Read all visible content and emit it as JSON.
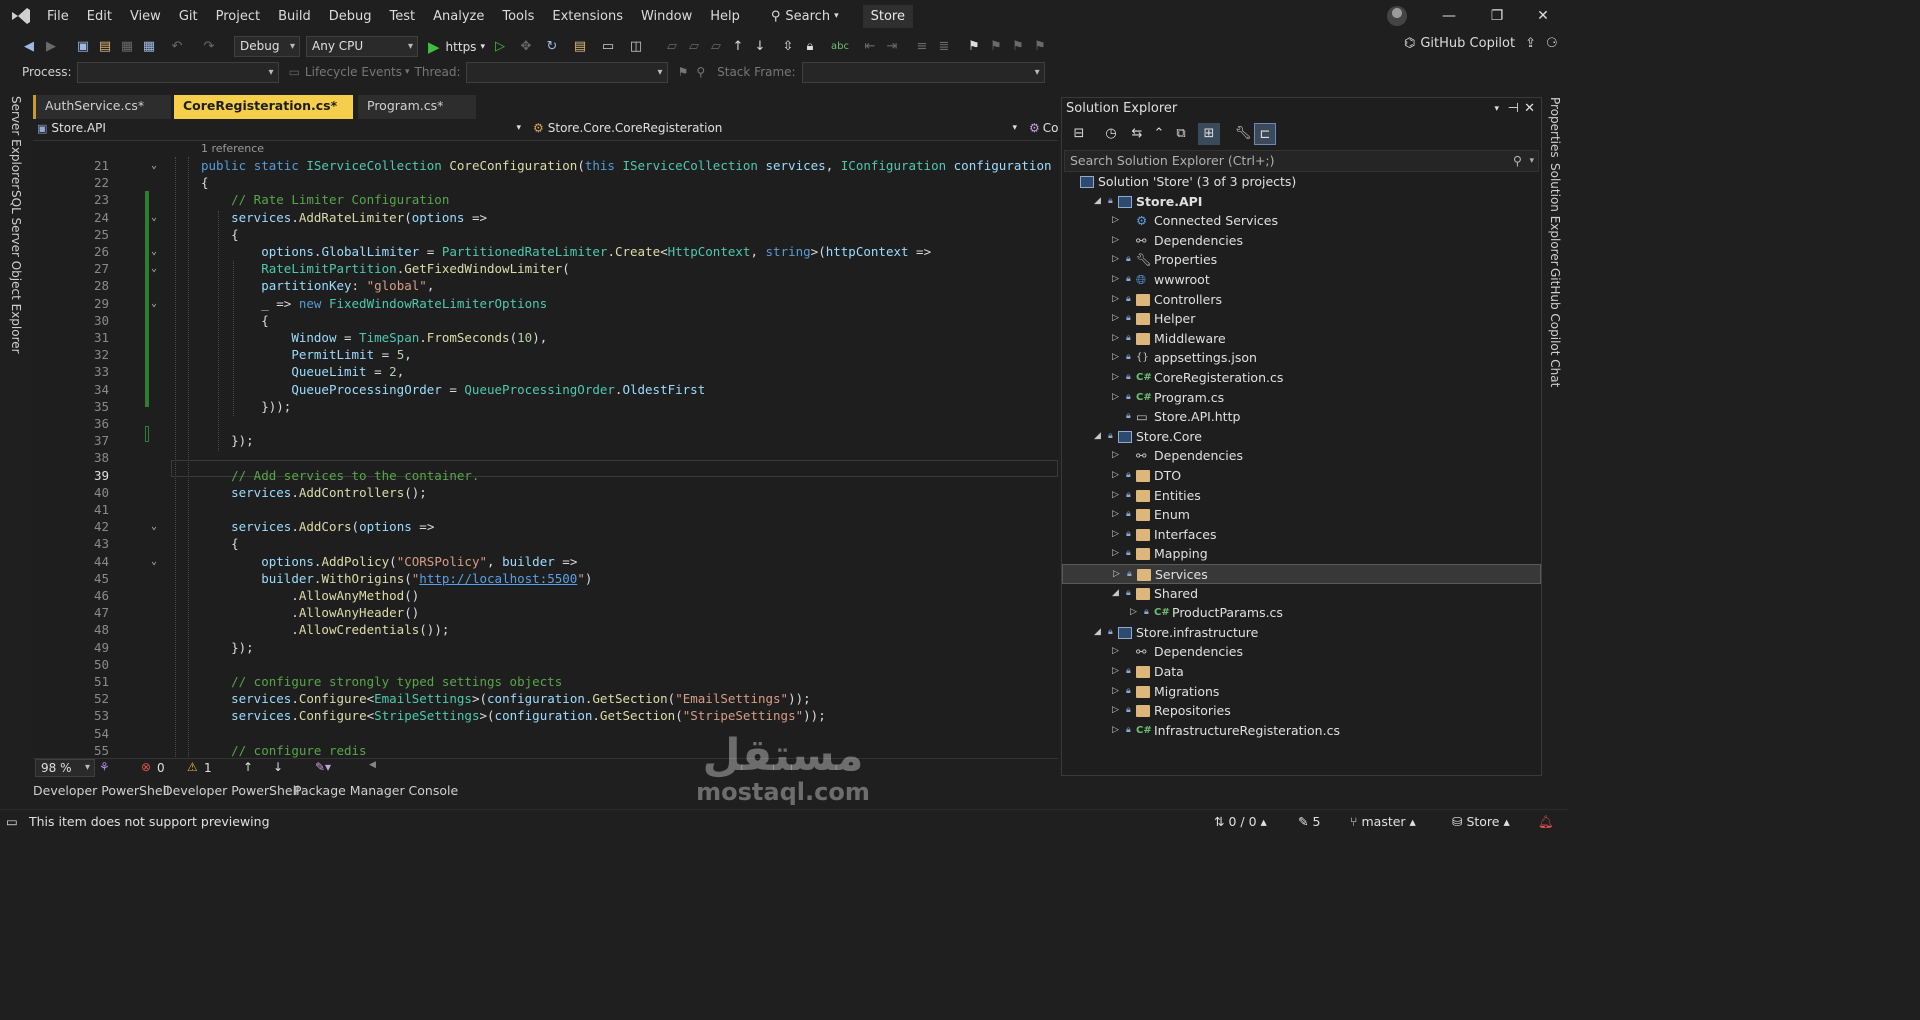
{
  "menu": {
    "items": [
      "File",
      "Edit",
      "View",
      "Git",
      "Project",
      "Build",
      "Debug",
      "Test",
      "Analyze",
      "Tools",
      "Extensions",
      "Window",
      "Help"
    ],
    "search_label": "Search",
    "solution_badge": "Store"
  },
  "toolbar": {
    "configuration": "Debug",
    "platform": "Any CPU",
    "run_target": "https",
    "copilot_label": "GitHub Copilot",
    "process_label": "Process:",
    "lifecycle_label": "Lifecycle Events",
    "thread_label": "Thread:",
    "stack_frame_label": "Stack Frame:"
  },
  "left_strip": {
    "server_explorer": "Server Explorer",
    "sql_explorer": "SQL Server Object Explorer"
  },
  "right_strip": {
    "properties": "Properties",
    "solution_explorer": "Solution Explorer",
    "copilot_chat": "GitHub Copilot Chat"
  },
  "editor": {
    "tabs": [
      "AuthService.cs*",
      "CoreRegisteration.cs*",
      "Program.cs*"
    ],
    "active_tab": "CoreRegisteration.cs*",
    "nav_project": "Store.API",
    "nav_class": "Store.Core.CoreRegisteration",
    "nav_member": "Co",
    "codelens": "1 reference",
    "zoom": "98 %",
    "errors": "0",
    "warnings": "1",
    "current_line": "39"
  },
  "code_lines": [
    {
      "n": "21",
      "t": "public static IServiceCollection CoreConfiguration(this IServiceCollection services, IConfiguration configuration"
    },
    {
      "n": "22",
      "t": "{"
    },
    {
      "n": "23",
      "t": "    // Rate Limiter Configuration"
    },
    {
      "n": "24",
      "t": "    services.AddRateLimiter(options =>"
    },
    {
      "n": "25",
      "t": "    {"
    },
    {
      "n": "26",
      "t": "        options.GlobalLimiter = PartitionedRateLimiter.Create<HttpContext, string>(httpContext =>"
    },
    {
      "n": "27",
      "t": "        RateLimitPartition.GetFixedWindowLimiter("
    },
    {
      "n": "28",
      "t": "        partitionKey: \"global\","
    },
    {
      "n": "29",
      "t": "        _ => new FixedWindowRateLimiterOptions"
    },
    {
      "n": "30",
      "t": "        {"
    },
    {
      "n": "31",
      "t": "            Window = TimeSpan.FromSeconds(10),"
    },
    {
      "n": "32",
      "t": "            PermitLimit = 5,"
    },
    {
      "n": "33",
      "t": "            QueueLimit = 2,"
    },
    {
      "n": "34",
      "t": "            QueueProcessingOrder = QueueProcessingOrder.OldestFirst"
    },
    {
      "n": "35",
      "t": "        }));"
    },
    {
      "n": "36",
      "t": ""
    },
    {
      "n": "37",
      "t": "    });"
    },
    {
      "n": "38",
      "t": ""
    },
    {
      "n": "39",
      "t": "    // Add services to the container."
    },
    {
      "n": "40",
      "t": "    services.AddControllers();"
    },
    {
      "n": "41",
      "t": ""
    },
    {
      "n": "42",
      "t": "    services.AddCors(options =>"
    },
    {
      "n": "43",
      "t": "    {"
    },
    {
      "n": "44",
      "t": "        options.AddPolicy(\"CORSPolicy\", builder =>"
    },
    {
      "n": "45",
      "t": "        builder.WithOrigins(\"http://localhost:5500\")"
    },
    {
      "n": "46",
      "t": "            .AllowAnyMethod()"
    },
    {
      "n": "47",
      "t": "            .AllowAnyHeader()"
    },
    {
      "n": "48",
      "t": "            .AllowCredentials());"
    },
    {
      "n": "49",
      "t": "    });"
    },
    {
      "n": "50",
      "t": ""
    },
    {
      "n": "51",
      "t": "    // configure strongly typed settings objects"
    },
    {
      "n": "52",
      "t": "    services.Configure<EmailSettings>(configuration.GetSection(\"EmailSettings\"));"
    },
    {
      "n": "53",
      "t": "    services.Configure<StripeSettings>(configuration.GetSection(\"StripeSettings\"));"
    },
    {
      "n": "54",
      "t": ""
    },
    {
      "n": "55",
      "t": "    // configure redis"
    }
  ],
  "solution_explorer": {
    "title": "Solution Explorer",
    "search_placeholder": "Search Solution Explorer (Ctrl+;)",
    "items": [
      {
        "label": "Solution 'Store' (3 of 3 projects)",
        "kind": "solution"
      },
      {
        "label": "Store.API",
        "kind": "project-bold"
      },
      {
        "label": "Connected Services",
        "kind": "service"
      },
      {
        "label": "Dependencies",
        "kind": "deps"
      },
      {
        "label": "Properties",
        "kind": "props"
      },
      {
        "label": "wwwroot",
        "kind": "globe"
      },
      {
        "label": "Controllers",
        "kind": "folder"
      },
      {
        "label": "Helper",
        "kind": "folder"
      },
      {
        "label": "Middleware",
        "kind": "folder"
      },
      {
        "label": "appsettings.json",
        "kind": "json"
      },
      {
        "label": "CoreRegisteration.cs",
        "kind": "cs"
      },
      {
        "label": "Program.cs",
        "kind": "cs"
      },
      {
        "label": "Store.API.http",
        "kind": "file"
      },
      {
        "label": "Store.Core",
        "kind": "project"
      },
      {
        "label": "Dependencies",
        "kind": "deps"
      },
      {
        "label": "DTO",
        "kind": "folder"
      },
      {
        "label": "Entities",
        "kind": "folder"
      },
      {
        "label": "Enum",
        "kind": "folder"
      },
      {
        "label": "Interfaces",
        "kind": "folder"
      },
      {
        "label": "Mapping",
        "kind": "folder"
      },
      {
        "label": "Services",
        "kind": "folder"
      },
      {
        "label": "Shared",
        "kind": "folder"
      },
      {
        "label": "ProductParams.cs",
        "kind": "cs"
      },
      {
        "label": "Store.infrastructure",
        "kind": "project"
      },
      {
        "label": "Dependencies",
        "kind": "deps"
      },
      {
        "label": "Data",
        "kind": "folder"
      },
      {
        "label": "Migrations",
        "kind": "folder"
      },
      {
        "label": "Repositories",
        "kind": "folder"
      },
      {
        "label": "InfrastructureRegisteration.cs",
        "kind": "cs"
      }
    ],
    "selected": "Services"
  },
  "bottom_tabs": [
    "Developer PowerShell",
    "Developer PowerShell",
    "Package Manager Console"
  ],
  "status": {
    "message": "This item does not support previewing",
    "changes": "0 / 0",
    "edits": "5",
    "branch": "master",
    "repo": "Store"
  },
  "watermark": {
    "arabic": "مستقل",
    "latin": "mostaql.com"
  },
  "colors": {
    "active_tab": "#f5cf4b",
    "keyword": "#569cd6",
    "type": "#4ec9b0",
    "method": "#dcdcaa",
    "string": "#d69d85",
    "comment": "#57a64a"
  }
}
